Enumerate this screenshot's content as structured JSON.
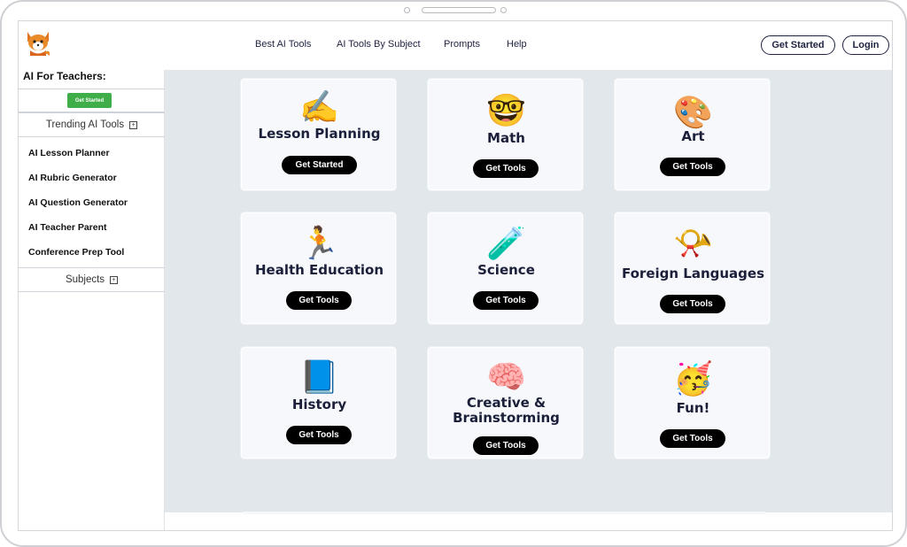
{
  "header": {
    "nav": [
      "Best AI Tools",
      "AI Tools By Subject",
      "Prompts",
      "Help"
    ],
    "get_started": "Get Started",
    "login": "Login"
  },
  "sidebar": {
    "title": "AI For Teachers:",
    "get_started": "Get Started",
    "trending": "Trending AI Tools",
    "items": [
      "AI Lesson Planner",
      "AI Rubric Generator",
      "AI Question Generator",
      "AI Teacher Parent",
      "Conference Prep Tool"
    ],
    "subjects": "Subjects",
    "expand_glyph": "+"
  },
  "cards": [
    {
      "emoji": "✍️",
      "title": "Lesson Planning",
      "button": "Get Started"
    },
    {
      "emoji": "🤓",
      "title": "Math",
      "button": "Get Tools"
    },
    {
      "emoji": "🎨",
      "title": "Art",
      "button": "Get Tools"
    },
    {
      "emoji": "🏃",
      "title": "Health Education",
      "button": "Get Tools"
    },
    {
      "emoji": "🧪",
      "title": "Science",
      "button": "Get Tools"
    },
    {
      "emoji": "📯",
      "title": "Foreign Languages",
      "button": "Get Tools"
    },
    {
      "emoji": "📘",
      "title": "History",
      "button": "Get Tools"
    },
    {
      "emoji": "🧠",
      "title": "Creative &",
      "title2": "Brainstorming",
      "button": "Get Tools"
    },
    {
      "emoji": "🥳",
      "title": "Fun!",
      "button": "Get Tools"
    }
  ],
  "colors": {
    "main_bg": "#e1e7ea",
    "card_bg": "#f6f8fb",
    "accent_green": "#3fae49",
    "text_dark": "#1c1f3a"
  },
  "icons": [
    "fox-logo-icon",
    "expand-icon"
  ]
}
